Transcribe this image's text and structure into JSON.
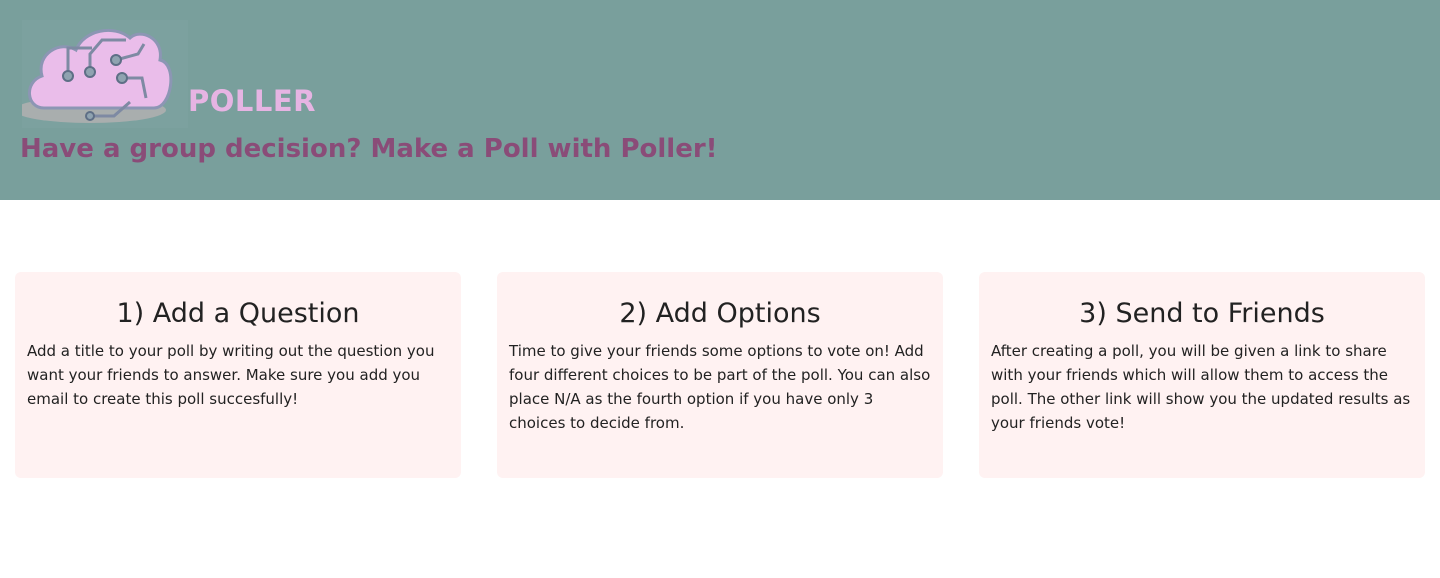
{
  "header": {
    "brand": "POLLER",
    "tagline": "Have a group decision? Make a Poll with Poller!",
    "logo_icon": "cloud-circuit-logo",
    "colors": {
      "background": "#799f9c",
      "brand": "#e6b4e3",
      "tagline": "#8a4c78"
    }
  },
  "steps": [
    {
      "title": "1) Add a Question",
      "body": "Add a title to your poll by writing out the question you want your friends to answer. Make sure you add you email to create this poll succesfully!"
    },
    {
      "title": "2) Add Options",
      "body": "Time to give your friends some options to vote on! Add four different choices to be part of the poll. You can also place N/A as the fourth option if you have only 3 choices to decide from."
    },
    {
      "title": "3) Send to Friends",
      "body": "After creating a poll, you will be given a link to share with your friends which will allow them to access the poll. The other link will show you the updated results as your friends vote!"
    }
  ],
  "colors": {
    "card_background": "#fff2f2"
  }
}
